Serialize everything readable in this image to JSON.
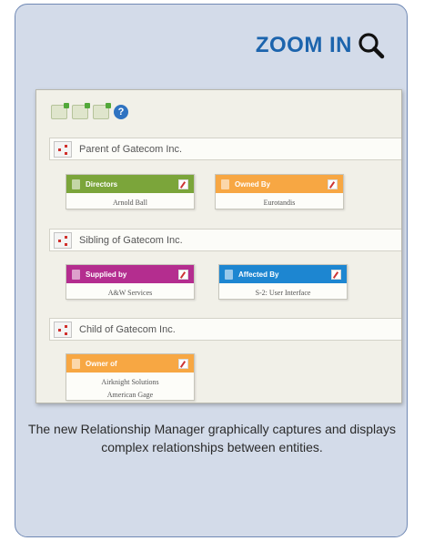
{
  "zoom": {
    "label": "ZOOM IN",
    "icon": "magnifier-icon"
  },
  "colors": {
    "card_bg": "#d3dbe9",
    "card_border": "#6f88b4",
    "heading": "#1c64ad",
    "green": "#7ba53a",
    "orange": "#f7a743",
    "magenta": "#b42d8f",
    "blue": "#1d86d1"
  },
  "toolbar": {
    "icons": [
      "add-relationship-icon",
      "add-relationship-icon",
      "add-relationship-icon",
      "help-icon"
    ],
    "help_glyph": "?"
  },
  "groups": [
    {
      "label": "Parent of Gatecom Inc.",
      "boxes": [
        {
          "title": "Directors",
          "color": "green",
          "items": [
            "Arnold Ball"
          ]
        },
        {
          "title": "Owned By",
          "color": "orange",
          "items": [
            "Eurotandis"
          ]
        }
      ]
    },
    {
      "label": "Sibling of Gatecom Inc.",
      "boxes": [
        {
          "title": "Supplied by",
          "color": "magenta",
          "items": [
            "A&W Services"
          ]
        },
        {
          "title": "Affected By",
          "color": "blue",
          "items": [
            "S-2: User Interface"
          ]
        }
      ]
    },
    {
      "label": "Child of Gatecom Inc.",
      "boxes": [
        {
          "title": "Owner of",
          "color": "orange",
          "items": [
            "Airknight Solutions",
            "American Gage"
          ]
        }
      ]
    }
  ],
  "caption": "The new Relationship Manager graphically captures and displays complex relationships between entities."
}
